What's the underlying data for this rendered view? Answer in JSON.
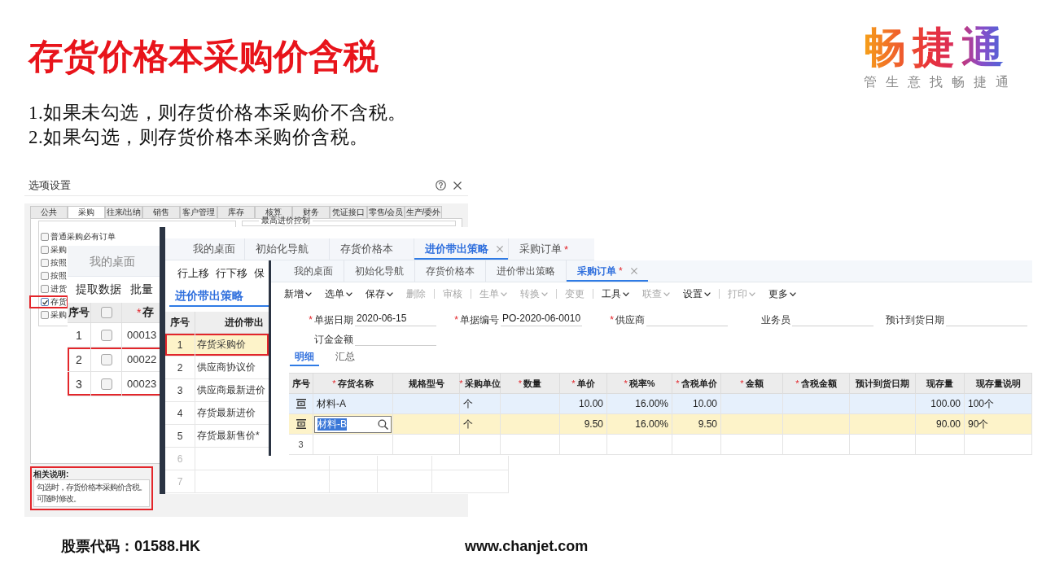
{
  "slide": {
    "title": "存货价格本采购价含税",
    "notes": [
      "1.如果未勾选，则存货价格本采购价不含税。",
      "2.如果勾选，则存货价格本采购价含税。"
    ]
  },
  "logo": {
    "wordmark": "畅捷通",
    "tagline": "管生意找畅捷通"
  },
  "options_dialog": {
    "title": "选项设置",
    "tabs": [
      {
        "label": "公共",
        "selected": false
      },
      {
        "label": "采购",
        "selected": true
      },
      {
        "label": "往来/出纳",
        "selected": false
      },
      {
        "label": "销售",
        "selected": false
      },
      {
        "label": "客户管理",
        "selected": false
      },
      {
        "label": "库存",
        "selected": false
      },
      {
        "label": "核算",
        "selected": false
      },
      {
        "label": "财务",
        "selected": false
      },
      {
        "label": "凭证接口",
        "selected": false
      },
      {
        "label": "零售/会员",
        "selected": false
      },
      {
        "label": "生产/委外",
        "selected": false
      }
    ],
    "options": [
      {
        "label": "普通采购必有订单",
        "checked": false,
        "highlighted": false
      },
      {
        "label": "采购",
        "checked": false,
        "highlighted": false
      },
      {
        "label": "按照",
        "checked": false,
        "highlighted": false
      },
      {
        "label": "按照",
        "checked": false,
        "highlighted": false
      },
      {
        "label": "进货",
        "checked": false,
        "highlighted": false
      },
      {
        "label": "存货",
        "checked": true,
        "highlighted": true
      },
      {
        "label": "采购",
        "checked": false,
        "highlighted": false
      }
    ],
    "group_title": "最高进价控制",
    "note": {
      "heading": "相关说明:",
      "lines": [
        "勾选时，存货价格本采购价含税。",
        "可随时修改。"
      ],
      "highlighted": true
    }
  },
  "price_window": {
    "tabs": [
      {
        "label": "我的桌面",
        "selected": false
      }
    ],
    "toolbar": [
      "提取数据",
      "批量"
    ],
    "header": {
      "index": "序号",
      "checked": false,
      "required_mark": "*",
      "code": "存"
    },
    "rows": [
      {
        "index": "1",
        "checked": false,
        "code": "00013",
        "highlighted": false
      },
      {
        "index": "2",
        "checked": false,
        "code": "00022",
        "highlighted": true
      },
      {
        "index": "3",
        "checked": false,
        "code": "00023",
        "highlighted": true
      }
    ]
  },
  "strategy_window": {
    "tabs": [
      {
        "label": "我的桌面",
        "selected": false
      },
      {
        "label": "初始化导航",
        "selected": false
      },
      {
        "label": "存货价格本",
        "selected": false
      },
      {
        "label": "进价带出策略",
        "selected": true
      },
      {
        "label": "采购订单",
        "selected": false,
        "modified_mark": "*"
      }
    ],
    "toolbar": [
      "行上移",
      "行下移",
      "保"
    ],
    "section_tab": {
      "label": "进价带出策略",
      "selected": true
    },
    "header": {
      "index": "序号",
      "name": "进价带出"
    },
    "rows": [
      {
        "kind": "entry",
        "index": "1",
        "name": "存货采购价",
        "selected": true,
        "highlighted": true
      },
      {
        "kind": "entry",
        "index": "2",
        "name": "供应商协议价",
        "selected": false,
        "highlighted": false
      },
      {
        "kind": "entry",
        "index": "3",
        "name": "供应商最新进价",
        "selected": false,
        "highlighted": false
      },
      {
        "kind": "entry",
        "index": "4",
        "name": "存货最新进价",
        "selected": false,
        "highlighted": false
      },
      {
        "kind": "entry",
        "index": "5",
        "name": "存货最新售价*",
        "selected": false,
        "highlighted": false
      },
      {
        "kind": "blank",
        "index": "6",
        "selected": false,
        "highlighted": false
      },
      {
        "kind": "blank",
        "index": "7",
        "selected": false,
        "highlighted": false
      }
    ]
  },
  "order_window": {
    "tabs": [
      {
        "label": "我的桌面",
        "selected": false
      },
      {
        "label": "初始化导航",
        "selected": false
      },
      {
        "label": "存货价格本",
        "selected": false
      },
      {
        "label": "进价带出策略",
        "selected": false
      },
      {
        "label": "采购订单",
        "selected": true,
        "modified_mark": "*"
      }
    ],
    "toolbar": [
      {
        "kind": "button",
        "label": "新增",
        "dropdown": true,
        "disabled": false
      },
      {
        "kind": "button",
        "label": "选单",
        "dropdown": true,
        "disabled": false
      },
      {
        "kind": "button",
        "label": "保存",
        "dropdown": true,
        "disabled": false
      },
      {
        "kind": "button",
        "label": "删除",
        "dropdown": false,
        "disabled": true
      },
      {
        "kind": "divider"
      },
      {
        "kind": "button",
        "label": "审核",
        "dropdown": false,
        "disabled": true
      },
      {
        "kind": "divider"
      },
      {
        "kind": "button",
        "label": "生单",
        "dropdown": true,
        "disabled": true
      },
      {
        "kind": "button",
        "label": "转换",
        "dropdown": true,
        "disabled": true
      },
      {
        "kind": "divider"
      },
      {
        "kind": "button",
        "label": "变更",
        "dropdown": false,
        "disabled": true
      },
      {
        "kind": "divider"
      },
      {
        "kind": "button",
        "label": "工具",
        "dropdown": true,
        "disabled": false
      },
      {
        "kind": "button",
        "label": "联查",
        "dropdown": true,
        "disabled": true
      },
      {
        "kind": "button",
        "label": "设置",
        "dropdown": true,
        "disabled": false
      },
      {
        "kind": "divider"
      },
      {
        "kind": "button",
        "label": "打印",
        "dropdown": true,
        "disabled": true
      },
      {
        "kind": "button",
        "label": "更多",
        "dropdown": true,
        "disabled": false
      }
    ],
    "form_rows": [
      [
        {
          "label": "单据日期",
          "required_mark": "*",
          "value": "2020-06-15"
        },
        {
          "label": "单据编号",
          "required_mark": "*",
          "value": "PO-2020-06-0010"
        },
        {
          "label": "供应商",
          "required_mark": "*"
        },
        {
          "label": "业务员"
        },
        {
          "label": "预计到货日期"
        }
      ],
      [
        {
          "label": "订金金额"
        }
      ]
    ],
    "detail_tabs": [
      {
        "label": "明细",
        "selected": true
      },
      {
        "label": "汇总",
        "selected": false
      }
    ],
    "table": {
      "columns": [
        {
          "label": "序号",
          "kind": "index"
        },
        {
          "label": "存货名称",
          "kind": "text",
          "required_mark": "*"
        },
        {
          "label": "规格型号",
          "kind": "text"
        },
        {
          "label": "采购单位",
          "kind": "text",
          "required_mark": "*"
        },
        {
          "label": "数量",
          "kind": "number",
          "required_mark": "*"
        },
        {
          "label": "单价",
          "kind": "number",
          "required_mark": "*"
        },
        {
          "label": "税率%",
          "kind": "number",
          "required_mark": "*"
        },
        {
          "label": "含税单价",
          "kind": "number",
          "required_mark": "*"
        },
        {
          "label": "金额",
          "kind": "number",
          "required_mark": "*"
        },
        {
          "label": "含税金额",
          "kind": "number",
          "required_mark": "*"
        },
        {
          "label": "预计到货日期",
          "kind": "text"
        },
        {
          "label": "现存量",
          "kind": "number"
        },
        {
          "label": "现存量说明",
          "kind": "text"
        }
      ],
      "rows": [
        {
          "kind": "item",
          "hovered": true,
          "selected": false,
          "editing": false,
          "cells": [
            null,
            "材料-A",
            null,
            "个",
            null,
            "10.00",
            "16.00%",
            "10.00",
            null,
            null,
            null,
            "100.00",
            "100个"
          ]
        },
        {
          "kind": "item",
          "hovered": false,
          "selected": true,
          "editing": true,
          "cells": [
            null,
            "材料-B",
            null,
            "个",
            null,
            "9.50",
            "16.00%",
            "9.50",
            null,
            null,
            null,
            "90.00",
            "90个"
          ]
        },
        {
          "kind": "blank",
          "hovered": false,
          "selected": false,
          "cells": [
            "3"
          ]
        }
      ]
    }
  },
  "footer": {
    "stock_code": "股票代码：01588.HK",
    "website": "www.chanjet.com"
  }
}
